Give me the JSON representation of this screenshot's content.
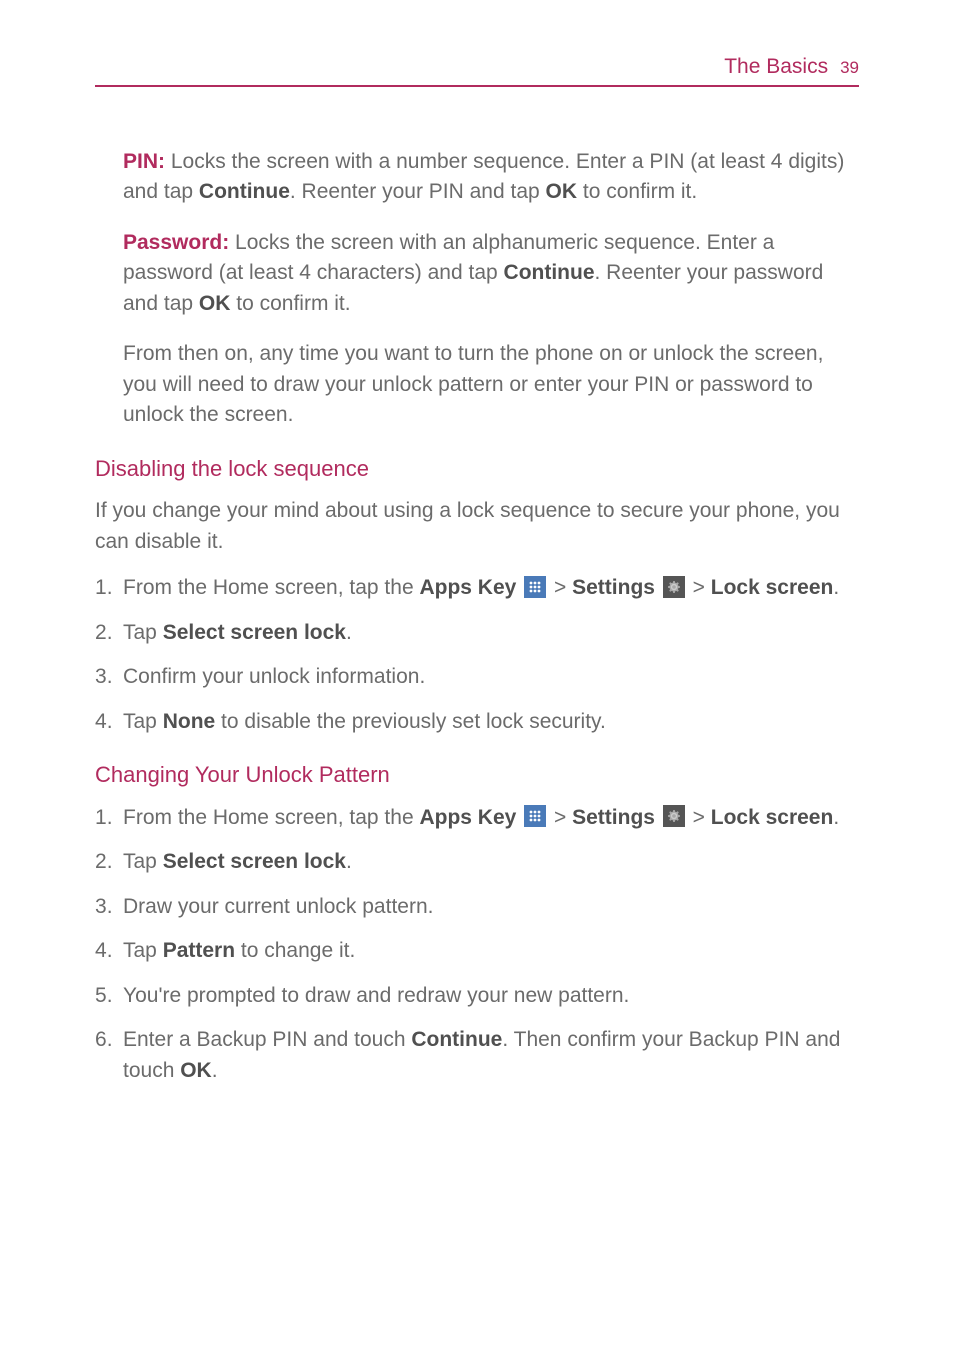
{
  "header": {
    "title": "The Basics",
    "page": "39"
  },
  "para": {
    "pin_label": "PIN:",
    "pin_text1": " Locks the screen with a number sequence. Enter a PIN (at least 4 digits) and tap ",
    "continue": "Continue",
    "pin_text2": ". Reenter your PIN and tap ",
    "ok": "OK",
    "pin_text3": " to confirm it.",
    "pw_label": "Password:",
    "pw_text1": " Locks the screen with an alphanumeric sequence. Enter a password (at least 4 characters) and tap ",
    "pw_text2": ". Reenter your password and tap ",
    "pw_text3": " to confirm it.",
    "from_then": "From then on, any time you want to turn the phone on or unlock the screen, you will need to draw your unlock pattern or enter your PIN or password to unlock the screen."
  },
  "section1": {
    "heading": "Disabling the lock sequence",
    "intro": "If you change your mind about using a lock sequence to secure your phone, you can disable it.",
    "step1_a": "From the Home screen, tap the ",
    "apps_key": "Apps Key",
    "gt": " > ",
    "settings": "Settings",
    "lock_screen": "Lock screen",
    "period": ".",
    "step2_a": "Tap ",
    "select_lock": "Select screen lock",
    "step3": "Confirm your unlock information.",
    "step4_a": "Tap ",
    "none": "None",
    "step4_b": " to disable the previously set lock security."
  },
  "section2": {
    "heading": "Changing Your Unlock Pattern",
    "step1_a": "From the Home screen, tap the ",
    "step2_a": "Tap ",
    "step3": "Draw your current unlock pattern.",
    "step4_a": "Tap ",
    "pattern": "Pattern",
    "step4_b": " to change it.",
    "step5": "You're prompted to draw and redraw your new pattern.",
    "step6_a": "Enter a Backup PIN and touch ",
    "step6_b": ". Then confirm your Backup PIN and touch "
  }
}
